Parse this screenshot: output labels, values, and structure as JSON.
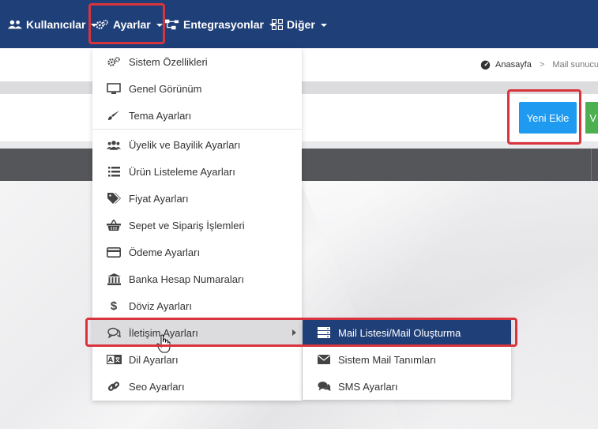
{
  "nav": {
    "users": "Kullanıcılar",
    "settings": "Ayarlar",
    "integrations": "Entegrasyonlar",
    "other": "Diğer"
  },
  "breadcrumb": {
    "home": "Anasayfa",
    "separator": ">",
    "current": "Mail sunucu"
  },
  "buttons": {
    "add_new": "Yeni Ekle",
    "second": "V"
  },
  "menu": {
    "items": [
      {
        "label": "Sistem Özellikleri",
        "icon": "gears-icon"
      },
      {
        "label": "Genel Görünüm",
        "icon": "desktop-icon"
      },
      {
        "label": "Tema Ayarları",
        "icon": "brush-icon"
      },
      {
        "label": "Üyelik ve Bayilik Ayarları",
        "icon": "users-icon"
      },
      {
        "label": "Ürün Listeleme Ayarları",
        "icon": "list-icon"
      },
      {
        "label": "Fiyat Ayarları",
        "icon": "tags-icon"
      },
      {
        "label": "Sepet ve Sipariş İşlemleri",
        "icon": "basket-icon"
      },
      {
        "label": "Ödeme Ayarları",
        "icon": "credit-card-icon"
      },
      {
        "label": "Banka Hesap Numaraları",
        "icon": "bank-icon"
      },
      {
        "label": "Döviz Ayarları",
        "icon": "dollar-icon"
      },
      {
        "label": "İletişim Ayarları",
        "icon": "comments-icon"
      },
      {
        "label": "Dil Ayarları",
        "icon": "language-icon"
      },
      {
        "label": "Seo Ayarları",
        "icon": "link-icon"
      }
    ]
  },
  "submenu": {
    "items": [
      {
        "label": "Mail Listesi/Mail Oluşturma",
        "icon": "server-icon"
      },
      {
        "label": "Sistem Mail Tanımları",
        "icon": "envelope-icon"
      },
      {
        "label": "SMS Ayarları",
        "icon": "sms-comments-icon"
      }
    ]
  },
  "colors": {
    "navbar": "#1f3f78",
    "highlight": "#d9343d",
    "primary_button": "#1e9af0",
    "success_button": "#4caf50",
    "active_submenu": "#1f3f78"
  }
}
